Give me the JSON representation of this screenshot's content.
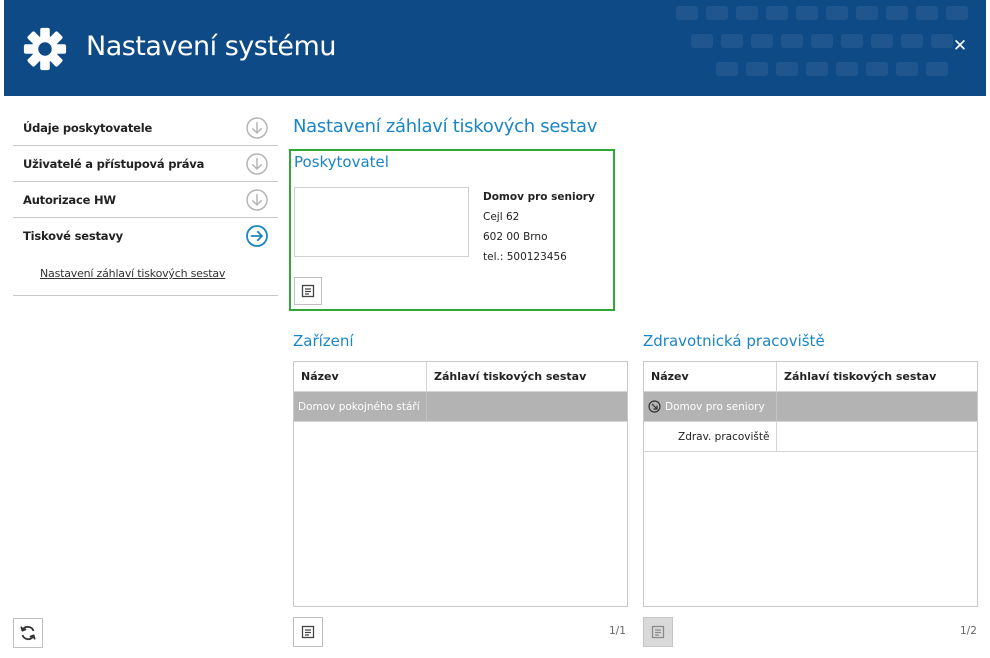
{
  "window": {
    "title": "Nastavení systému",
    "close_symbol": "✕",
    "header_color": "#0e4a86"
  },
  "sidebar": {
    "items": [
      {
        "label": "Údaje poskytovatele",
        "icon": "arrow-down-circle-icon"
      },
      {
        "label": "Uživatelé a přístupová práva",
        "icon": "arrow-down-circle-icon"
      },
      {
        "label": "Autorizace HW",
        "icon": "arrow-down-circle-icon"
      },
      {
        "label": "Tiskové sestavy",
        "icon": "arrow-right-circle-icon",
        "active": true
      }
    ],
    "subitem": "Nastavení záhlaví tiskových sestav",
    "refresh_icon": "refresh-icon"
  },
  "main": {
    "title": "Nastavení záhlaví tiskových sestav",
    "provider": {
      "section_title": "Poskytovatel",
      "name": "Domov pro seniory",
      "street": "Cejl 62",
      "city": "602 00 Brno",
      "phone": "tel.: 500123456"
    },
    "devices": {
      "section_title": "Zařízení",
      "columns": [
        "Název",
        "Záhlaví tiskových sestav"
      ],
      "rows": [
        {
          "name": "Domov pokojného stáří",
          "header": ""
        }
      ],
      "pager": "1/1"
    },
    "workplaces": {
      "section_title": "Zdravotnická pracoviště",
      "columns": [
        "Název",
        "Záhlaví tiskových sestav"
      ],
      "rows": [
        {
          "name": "Domov pro seniory",
          "header": ""
        },
        {
          "name": "Zdrav. pracoviště",
          "header": ""
        }
      ],
      "pager": "1/2"
    }
  },
  "colors": {
    "accent": "#1a85c8",
    "highlight_border": "#2fa836",
    "selected_row": "#b3b3b3"
  }
}
